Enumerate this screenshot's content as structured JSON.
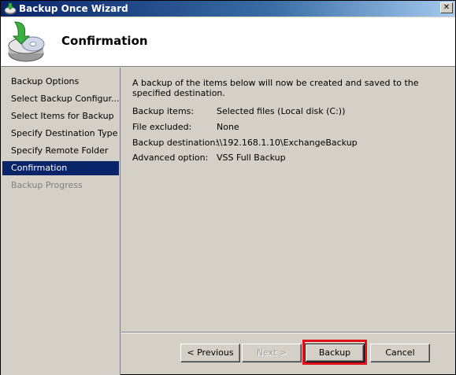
{
  "window": {
    "title": "Backup Once Wizard",
    "close_glyph": "✕",
    "icons": {
      "title": "backup-wizard-icon",
      "close": "close-icon"
    }
  },
  "header": {
    "title": "Confirmation",
    "icon": "backup-disk-icon"
  },
  "sidebar": {
    "items": [
      {
        "label": "Backup Options",
        "state": "normal"
      },
      {
        "label": "Select Backup Configur...",
        "state": "normal"
      },
      {
        "label": "Select Items for Backup",
        "state": "normal"
      },
      {
        "label": "Specify Destination Type",
        "state": "normal"
      },
      {
        "label": "Specify Remote Folder",
        "state": "normal"
      },
      {
        "label": "Confirmation",
        "state": "selected"
      },
      {
        "label": "Backup Progress",
        "state": "disabled"
      }
    ]
  },
  "content": {
    "intro": "A backup of the items below will now be created and saved to the specified destination.",
    "details": [
      {
        "key": "Backup items:",
        "value": "Selected files (Local disk (C:))"
      },
      {
        "key": "File excluded:",
        "value": "None"
      },
      {
        "key": "Backup destination:",
        "value": "\\\\192.168.1.10\\ExchangeBackup"
      },
      {
        "key": "Advanced option:",
        "value": "VSS Full Backup"
      }
    ]
  },
  "buttons": {
    "previous": "< Previous",
    "next": "Next >",
    "backup": "Backup",
    "cancel": "Cancel"
  },
  "colors": {
    "titlebar": "#0a246a",
    "selection": "#0a246a",
    "highlight_box": "#e0101a",
    "face": "#d4d0c8"
  }
}
